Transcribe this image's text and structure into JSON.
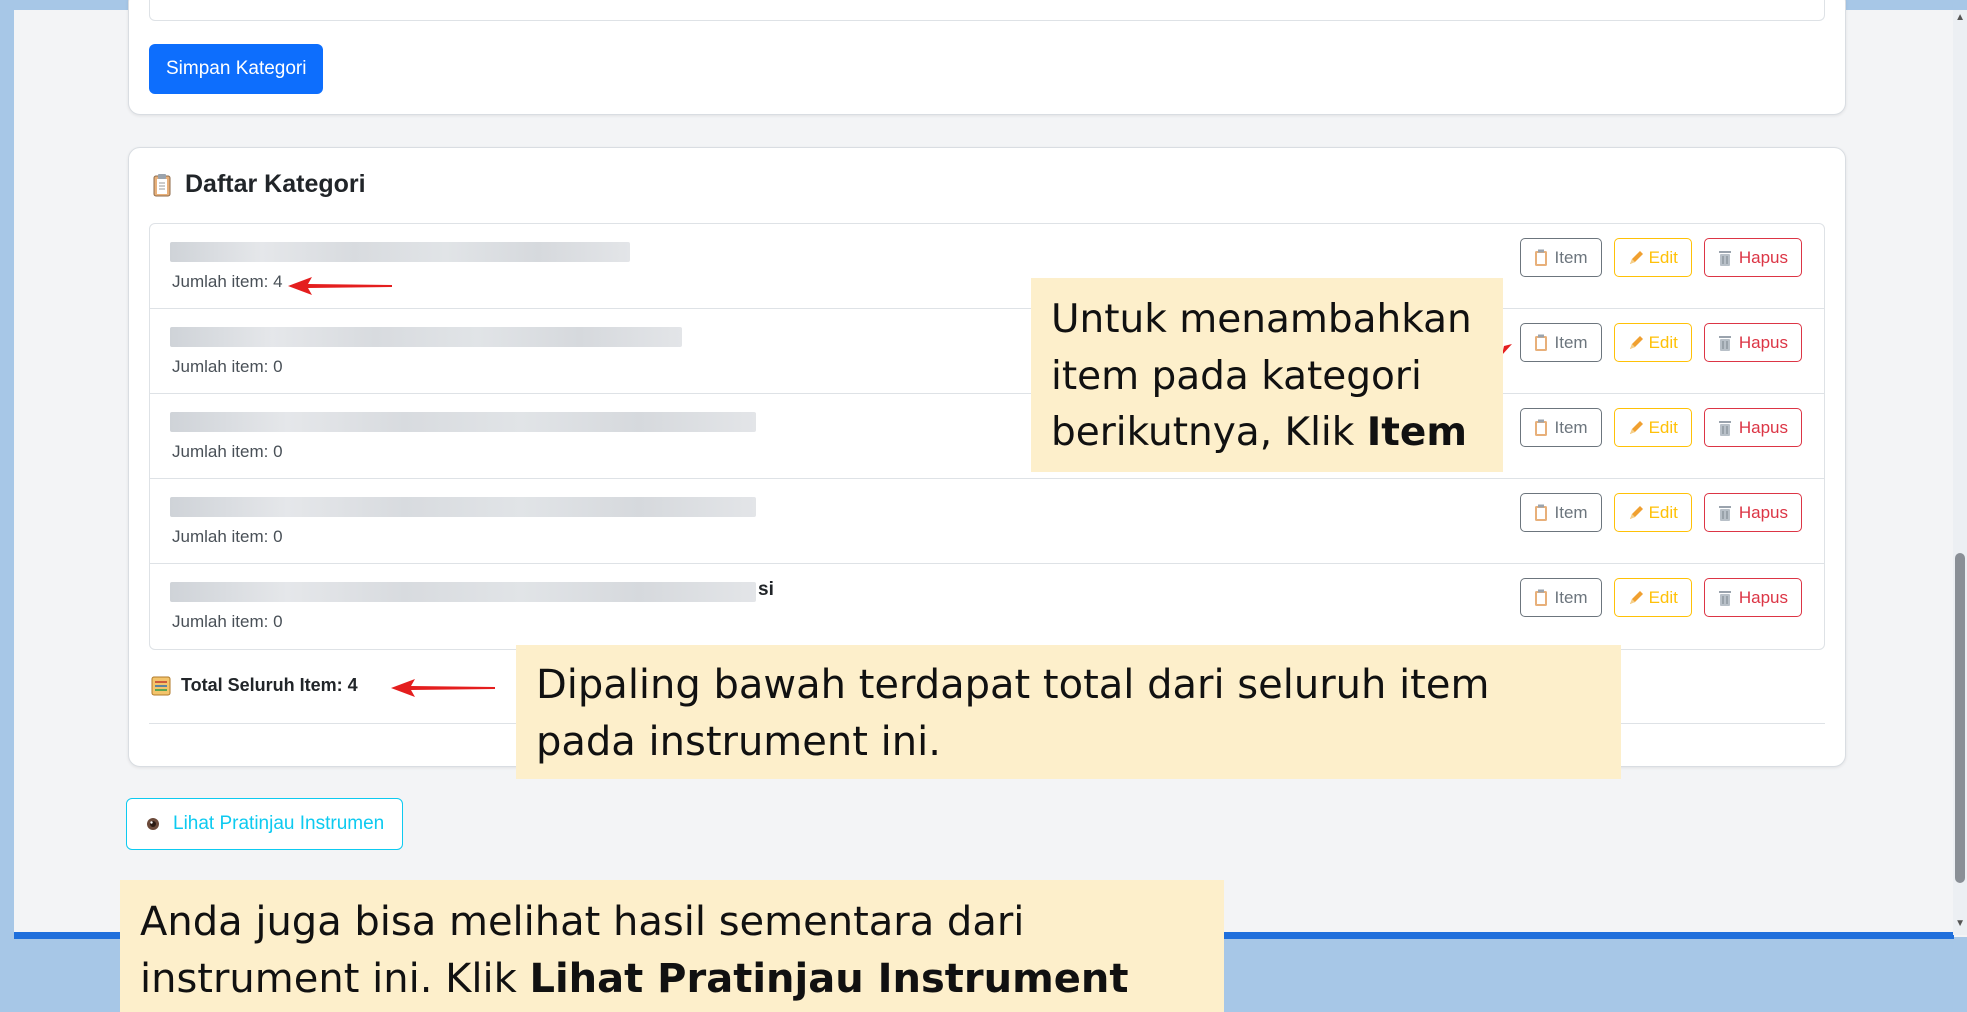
{
  "top_card": {
    "save_button": "Simpan Kategori"
  },
  "list_card": {
    "title": "Daftar Kategori",
    "rows": [
      {
        "count_label": "Jumlah item: 4",
        "tail": ""
      },
      {
        "count_label": "Jumlah item: 0",
        "tail": ""
      },
      {
        "count_label": "Jumlah item: 0",
        "tail": ""
      },
      {
        "count_label": "Jumlah item: 0",
        "tail": ""
      },
      {
        "count_label": "Jumlah item: 0",
        "tail": "si"
      }
    ],
    "actions": {
      "item": "Item",
      "edit": "Edit",
      "delete": "Hapus"
    },
    "total_label": "Total Seluruh Item: 4"
  },
  "preview_button": "Lihat Pratinjau Instrumen",
  "notes": {
    "note1_text": "Untuk menambahkan item pada kategori berikutnya, Klik ",
    "note1_bold": "Item",
    "note2_text": "Dipaling bawah terdapat total dari seluruh item pada instrument ini.",
    "note3_text": "Anda juga bisa melihat hasil sementara dari instrument ini. Klik ",
    "note3_bold": "Lihat Pratinjau Instrument"
  },
  "colors": {
    "primary": "#0d6efd",
    "secondary": "#6c757d",
    "warning": "#ffc107",
    "danger": "#dc3545",
    "info": "#0dcaf0",
    "note_bg": "#fdefcb",
    "arrow": "#e41e1e"
  }
}
